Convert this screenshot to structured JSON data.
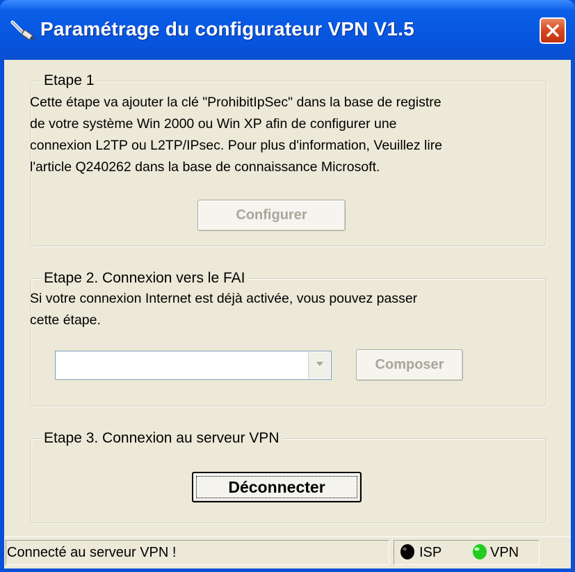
{
  "window": {
    "title": "Paramétrage du configurateur VPN V1.5",
    "close_icon": "close-icon"
  },
  "step1": {
    "legend": "Etape 1",
    "lines": [
      "Cette étape va ajouter la clé \"ProhibitIpSec\" dans la base de registre",
      "de votre système Win 2000 ou Win XP afin de configurer une",
      "connexion L2TP ou L2TP/IPsec. Pour plus d'information, Veuillez lire",
      "l'article Q240262 dans la base de connaissance Microsoft."
    ],
    "button_label": "Configurer"
  },
  "step2": {
    "legend": "Etape 2. Connexion vers le FAI",
    "lines": [
      "Si votre connexion Internet est déjà activée, vous pouvez passer",
      "cette étape."
    ],
    "combo_value": "",
    "button_label": "Composer"
  },
  "step3": {
    "legend": "Etape 3. Connexion au serveur VPN",
    "button_label": "Déconnecter"
  },
  "status": {
    "message": "Connecté au serveur VPN !",
    "isp_label": "ISP",
    "vpn_label": "VPN",
    "isp_color": "#000000",
    "vpn_color": "#22cc22"
  }
}
